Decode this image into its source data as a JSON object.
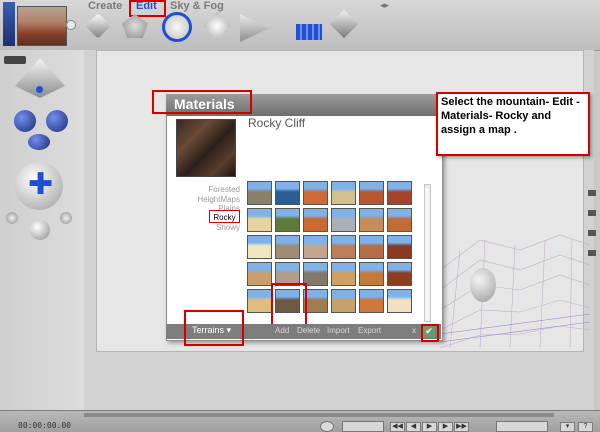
{
  "top_palette": {
    "create_label": "Create",
    "edit_label": "Edit",
    "sky_fog_label": "Sky & Fog"
  },
  "materials": {
    "title": "Materials",
    "material_name": "Rocky Cliff",
    "categories": [
      "Forested",
      "HeightMaps",
      "Plains",
      "Rocky",
      "Snowy"
    ],
    "selected_category": "Rocky",
    "footer": {
      "terrains_label": "Terrains ▾",
      "add_label": "Add",
      "delete_label": "Delete",
      "import_label": "Import",
      "export_label": "Export",
      "cancel_label": "x",
      "ok_label": "✔"
    },
    "thumbnail_colors": [
      [
        "#8a7f6c",
        "#2a5c95",
        "#cc6a3a",
        "#d2c08d",
        "#b5582e",
        "#a2452a"
      ],
      [
        "#e6d39d",
        "#5e7b39",
        "#c96a2f",
        "#a9b0b8",
        "#c68c5a",
        "#c36b35"
      ],
      [
        "#f0e6c0",
        "#9f8c74",
        "#c3a48f",
        "#b87f5a",
        "#b46c49",
        "#8b3a22"
      ],
      [
        "#c99d6c",
        "#b29c86",
        "#84786a",
        "#d09f63",
        "#c47a3b",
        "#8f3d1e"
      ],
      [
        "#e0bb82",
        "#6e5a40",
        "#a07c55",
        "#c5a16b",
        "#d0763b",
        "#f1e1c2"
      ]
    ]
  },
  "callout": {
    "text": "Select the mountain- Edit - Materials- Rocky and assign a map ."
  },
  "timeline": {
    "timecode": "00:00:00.00"
  },
  "colors": {
    "annotation_red": "#d40000",
    "dialog_header": "#7a7a7a",
    "accent_blue": "#1f4fd1"
  }
}
